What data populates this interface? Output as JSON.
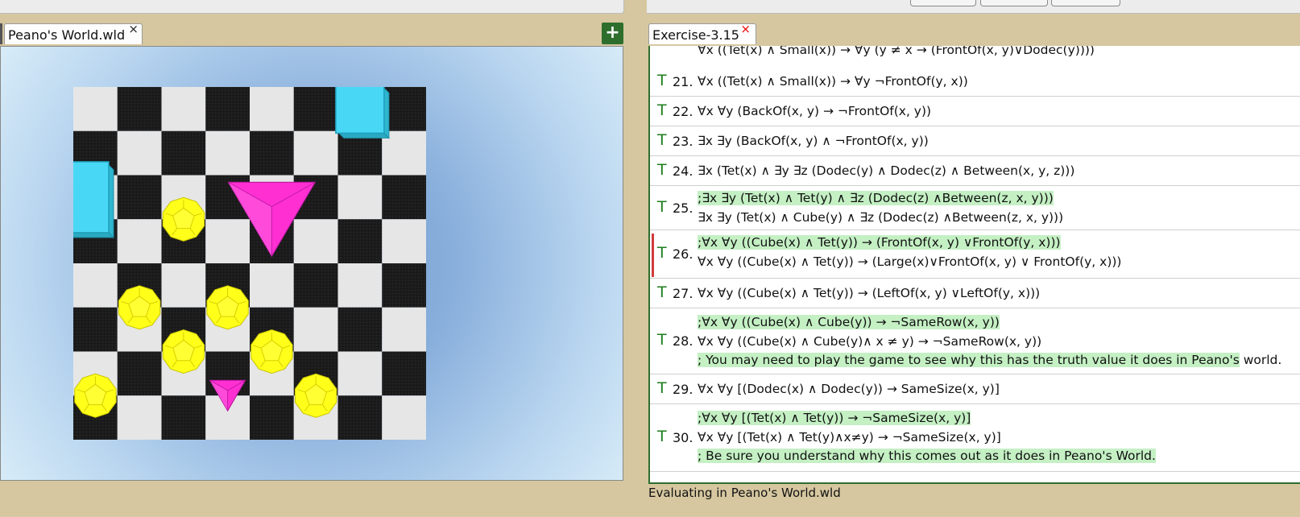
{
  "world_tab": {
    "title": "Peano's World.wld",
    "close": "×"
  },
  "sentence_tab": {
    "title": "Exercise-3.15",
    "close": "×"
  },
  "add_button": "+",
  "status": "Evaluating in Peano's World.wld",
  "sentences": [
    {
      "tv": "",
      "num": "",
      "lines": [
        {
          "text": "∀x ((Tet(x) ∧ Small(x)) → ∀y (y ≠ x → (FrontOf(x, y)∨Dodec(y))))",
          "comment": false
        }
      ]
    },
    {
      "tv": "T",
      "num": "21.",
      "lines": [
        {
          "text": "∀x ((Tet(x) ∧ Small(x)) → ∀y ¬FrontOf(y, x))",
          "comment": false
        }
      ]
    },
    {
      "tv": "T",
      "num": "22.",
      "lines": [
        {
          "text": "∀x ∀y (BackOf(x, y) → ¬FrontOf(x, y))",
          "comment": false
        }
      ]
    },
    {
      "tv": "T",
      "num": "23.",
      "lines": [
        {
          "text": "∃x ∃y (BackOf(x, y) ∧ ¬FrontOf(x, y))",
          "comment": false
        }
      ]
    },
    {
      "tv": "T",
      "num": "24.",
      "lines": [
        {
          "text": "∃x (Tet(x) ∧ ∃y ∃z (Dodec(y) ∧ Dodec(z) ∧ Between(x, y, z)))",
          "comment": false
        }
      ]
    },
    {
      "tv": "T",
      "num": "25.",
      "lines": [
        {
          "text": ";∃x ∃y (Tet(x) ∧ Tet(y) ∧ ∃z (Dodec(z) ∧Between(z, x, y))) ",
          "comment": true
        },
        {
          "text": "∃x ∃y (Tet(x) ∧ Cube(y) ∧ ∃z (Dodec(z) ∧Between(z, x, y)))",
          "comment": false
        }
      ]
    },
    {
      "tv": "T",
      "num": "26.",
      "marked": true,
      "lines": [
        {
          "text": ";∀x ∀y ((Cube(x) ∧ Tet(y)) → (FrontOf(x, y) ∨FrontOf(y, x)))",
          "comment": true
        },
        {
          "text": "∀x ∀y ((Cube(x) ∧ Tet(y)) → (Large(x)∨FrontOf(x, y) ∨ FrontOf(y, x)))",
          "comment": false
        }
      ]
    },
    {
      "tv": "T",
      "num": "27.",
      "lines": [
        {
          "text": "∀x ∀y ((Cube(x) ∧ Tet(y)) → (LeftOf(x, y) ∨LeftOf(y, x)))",
          "comment": false
        }
      ]
    },
    {
      "tv": "T",
      "num": "28.",
      "lines": [
        {
          "text": ";∀x ∀y ((Cube(x) ∧ Cube(y)) → ¬SameRow(x, y)) ",
          "comment": true
        },
        {
          "text": "∀x ∀y ((Cube(x) ∧ Cube(y)∧ x ≠ y) → ¬SameRow(x, y))",
          "comment": false
        },
        {
          "text": "; You may need to play the game to see why this has the truth value it does in Peano's",
          "comment": true,
          "tail": " world."
        }
      ]
    },
    {
      "tv": "T",
      "num": "29.",
      "lines": [
        {
          "text": "∀x ∀y [(Dodec(x) ∧ Dodec(y)) → SameSize(x, y)]",
          "comment": false
        }
      ]
    },
    {
      "tv": "T",
      "num": "30.",
      "lines": [
        {
          "text": ";∀x ∀y [(Tet(x) ∧ Tet(y)) → ¬SameSize(x, y)] ",
          "comment": true
        },
        {
          "text": "∀x ∀y [(Tet(x) ∧ Tet(y)∧x≠y) → ¬SameSize(x, y)]",
          "comment": false
        },
        {
          "text": "; Be sure you understand why this comes out as it does in Peano's World.  ",
          "comment": true
        }
      ]
    }
  ],
  "colors": {
    "accent": "#2d6e2d",
    "true_green": "#1c7d1c",
    "comment_bg": "#c4f0c4",
    "cube": "#48d8f5",
    "tet": "#ff2fd2",
    "dodec": "#ffff1a",
    "board_dark": "#1c1c1c",
    "board_light": "#e6e6e6"
  },
  "world": {
    "grid": 8,
    "objects": [
      {
        "shape": "cube",
        "size": "medium",
        "col": 6,
        "row": 0,
        "name": "cube-icon"
      },
      {
        "shape": "cube",
        "size": "large",
        "col": -0.5,
        "row": 2,
        "name": "cube-icon"
      },
      {
        "shape": "tet",
        "size": "large",
        "col": 4,
        "row": 2.5,
        "name": "tetrahedron-icon"
      },
      {
        "shape": "dodec",
        "size": "small",
        "col": 2,
        "row": 2.5,
        "name": "dodecahedron-icon"
      },
      {
        "shape": "dodec",
        "size": "small",
        "col": 1,
        "row": 4.5,
        "name": "dodecahedron-icon"
      },
      {
        "shape": "dodec",
        "size": "small",
        "col": 3,
        "row": 4.5,
        "name": "dodecahedron-icon"
      },
      {
        "shape": "dodec",
        "size": "small",
        "col": 2,
        "row": 5.5,
        "name": "dodecahedron-icon"
      },
      {
        "shape": "dodec",
        "size": "small",
        "col": 4,
        "row": 5.5,
        "name": "dodecahedron-icon"
      },
      {
        "shape": "dodec",
        "size": "small",
        "col": 0,
        "row": 6.5,
        "name": "dodecahedron-icon"
      },
      {
        "shape": "tet",
        "size": "small",
        "col": 3,
        "row": 6.5,
        "name": "tetrahedron-icon"
      },
      {
        "shape": "dodec",
        "size": "small",
        "col": 5,
        "row": 6.5,
        "name": "dodecahedron-icon"
      }
    ]
  }
}
